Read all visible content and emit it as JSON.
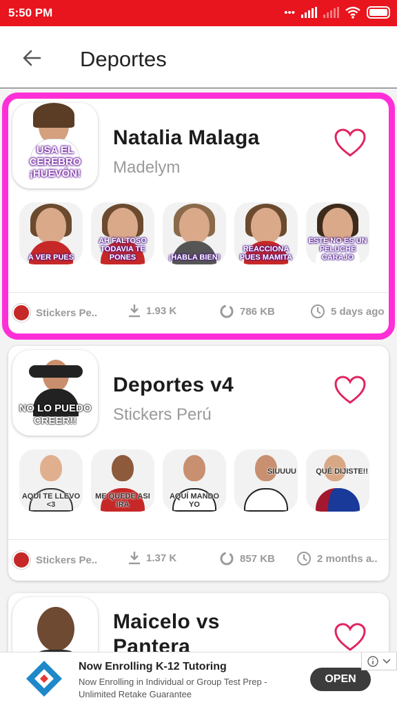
{
  "status_bar": {
    "time": "5:50 PM"
  },
  "app_bar": {
    "title": "Deportes"
  },
  "packs": [
    {
      "name": "Natalia Malaga",
      "author": "Madelym",
      "thumb_caption": "USA EL CEREBRO ¡HUEVÓN!",
      "stickers": [
        "A VER PUES",
        "AH FALTOSO TODAVIA TE PONES",
        "¡HABLA BIEN!",
        "REACCIONA PUES MAMITA",
        "ESTE NO ES UN PELUCHE CARAJO"
      ],
      "publisher": "Stickers Pe..",
      "downloads": "1.93 K",
      "size": "786 KB",
      "updated": "5 days ago"
    },
    {
      "name": "Deportes v4",
      "author": "Stickers Perú",
      "thumb_caption": "NO LO PUEDO CREER!!",
      "stickers": [
        "AQUÍ TE LLEVO <3",
        "ME QUEDE ASI IRA",
        "AQUÍ MANDO YO",
        "SIUUUU",
        "QUÉ DIJISTE!!"
      ],
      "publisher": "Stickers Pe..",
      "downloads": "1.37 K",
      "size": "857 KB",
      "updated": "2 months a.."
    },
    {
      "name": "Maicelo vs Pantera"
    }
  ],
  "ad": {
    "headline": "Now Enrolling K-12 Tutoring",
    "body": "Now Enrolling in Individual or Group Test Prep - Unlimited Retake Guarantee",
    "cta": "OPEN"
  },
  "colors": {
    "accent": "#e8141e",
    "highlight": "#ff2fd8",
    "heart": "#e0245e"
  }
}
